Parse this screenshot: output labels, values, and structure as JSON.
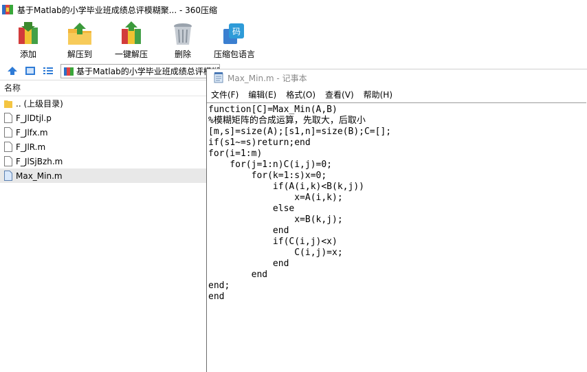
{
  "archive_window": {
    "title": "基于Matlab的小学毕业班成绩总评模糊聚... - 360压缩",
    "toolbar": {
      "add_label": "添加",
      "extract_to_label": "解压到",
      "one_click_extract_label": "一键解压",
      "delete_label": "删除",
      "encoding_label": "压缩包语言",
      "encoding_icon_text": "码"
    },
    "address": {
      "path": "基于Matlab的小学毕业班成绩总评模糊聚类"
    },
    "file_list": {
      "column_name": "名称",
      "items": [
        {
          "name": ".. (上级目录)",
          "type": "folder"
        },
        {
          "name": "F_JlDtjl.p",
          "type": "file"
        },
        {
          "name": "F_Jlfx.m",
          "type": "file"
        },
        {
          "name": "F_JlR.m",
          "type": "file"
        },
        {
          "name": "F_JlSjBzh.m",
          "type": "file"
        },
        {
          "name": "Max_Min.m",
          "type": "file",
          "selected": true
        }
      ]
    }
  },
  "notepad": {
    "title": "Max_Min.m - 记事本",
    "menu": {
      "file": "文件(F)",
      "edit": "编辑(E)",
      "format": "格式(O)",
      "view": "查看(V)",
      "help": "帮助(H)"
    },
    "content": "function[C]=Max_Min(A,B)\n%模糊矩阵的合成运算，先取大，后取小\n[m,s]=size(A);[s1,n]=size(B);C=[];\nif(s1~=s)return;end\nfor(i=1:m)\n    for(j=1:n)C(i,j)=0;\n        for(k=1:s)x=0;\n            if(A(i,k)<B(k,j))\n                x=A(i,k);\n            else\n                x=B(k,j);\n            end\n            if(C(i,j)<x)\n                C(i,j)=x;\n            end\n        end\nend;\nend"
  },
  "colors": {
    "selected_row": "#e8e8e8",
    "notepad_title": "#8a8a8a",
    "folder": "#f4c542",
    "nav_blue": "#2e7bd6"
  }
}
